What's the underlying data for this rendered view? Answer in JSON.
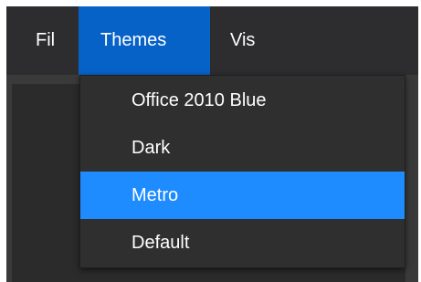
{
  "menubar": {
    "items": [
      {
        "label": "Fil"
      },
      {
        "label": "Themes"
      },
      {
        "label": "Vis"
      }
    ]
  },
  "themes_menu": {
    "items": [
      {
        "label": "Office 2010 Blue"
      },
      {
        "label": "Dark"
      },
      {
        "label": "Metro",
        "selected": true
      },
      {
        "label": "Default"
      }
    ]
  },
  "colors": {
    "menubar_bg": "#2d2d30",
    "active_menu_bg": "#0762c8",
    "highlight_bg": "#1e8cff",
    "dropdown_bg": "#2f2f2f",
    "text": "#ffffff"
  }
}
